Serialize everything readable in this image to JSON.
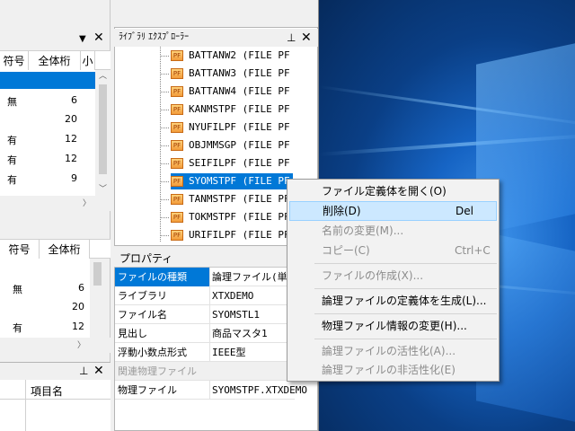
{
  "left_grid_top": {
    "headers": [
      "符号",
      "全体桁",
      "小"
    ],
    "rows": [
      {
        "sign": "",
        "digits": ""
      },
      {
        "sign": "無",
        "digits": "6"
      },
      {
        "sign": "",
        "digits": "20"
      },
      {
        "sign": "有",
        "digits": "12"
      },
      {
        "sign": "有",
        "digits": "12"
      },
      {
        "sign": "有",
        "digits": "9"
      }
    ]
  },
  "left_grid_bottom": {
    "headers": [
      "符号",
      "全体桁"
    ],
    "rows": [
      {
        "sign": "無",
        "digits": "6"
      },
      {
        "sign": "",
        "digits": "20"
      },
      {
        "sign": "有",
        "digits": "12"
      }
    ]
  },
  "bottom_left_panel": {
    "column": "項目名"
  },
  "library_explorer": {
    "title": "ﾗｲﾌﾞﾗﾘ ｴｸｽﾌﾟﾛｰﾗｰ",
    "pin_icon": "pin-icon",
    "close_icon": "close-icon",
    "icon_text": "PF",
    "items": [
      "BATTANW2 (FILE PF )",
      "BATTANW3 (FILE PF )",
      "BATTANW4 (FILE PF )",
      "KANMSTPF (FILE PF )",
      "NYUFILPF (FILE PF )",
      "OBJMMSGP (FILE PF )",
      "SEIFILPF (FILE PF )",
      "SYOMSTPF (FILE PF )",
      "TANMSTPF (FILE PF )",
      "TOKMSTPF (FILE PF )",
      "URIFILPF (FILE PF )"
    ],
    "selected_index": 7
  },
  "properties": {
    "title": "プロパティ",
    "rows": [
      {
        "name": "ファイルの種類",
        "value": "論理ファイル(単純"
      },
      {
        "name": "ライブラリ",
        "value": "XTXDEMO"
      },
      {
        "name": "ファイル名",
        "value": "SYOMSTL1"
      },
      {
        "name": "見出し",
        "value": "商品マスタ1"
      },
      {
        "name": "浮動小数点形式",
        "value": "IEEE型"
      },
      {
        "name": "関連物理ファイル",
        "value": ""
      },
      {
        "name": "物理ファイル",
        "value": "SYOMSTPF.XTXDEMO"
      }
    ]
  },
  "context_menu": {
    "items": [
      {
        "label": "ファイル定義体を開く(O)",
        "shortcut": "",
        "disabled": false
      },
      {
        "label": "削除(D)",
        "shortcut": "Del",
        "disabled": false
      },
      {
        "label": "名前の変更(M)...",
        "shortcut": "",
        "disabled": true
      },
      {
        "label": "コピー(C)",
        "shortcut": "Ctrl+C",
        "disabled": true
      },
      {
        "label": "ファイルの作成(X)...",
        "shortcut": "",
        "disabled": true
      },
      {
        "label": "論理ファイルの定義体を生成(L)...",
        "shortcut": "",
        "disabled": false
      },
      {
        "label": "物理ファイル情報の変更(H)...",
        "shortcut": "",
        "disabled": false
      },
      {
        "label": "論理ファイルの活性化(A)...",
        "shortcut": "",
        "disabled": true
      },
      {
        "label": "論理ファイルの非活性化(E)",
        "shortcut": "",
        "disabled": true
      }
    ],
    "highlighted_index": 1
  },
  "colors": {
    "selection": "#0078d7",
    "menu_hover": "#cce8ff",
    "disabled_text": "#8c8c8c",
    "file_icon": "#f29b3a"
  }
}
